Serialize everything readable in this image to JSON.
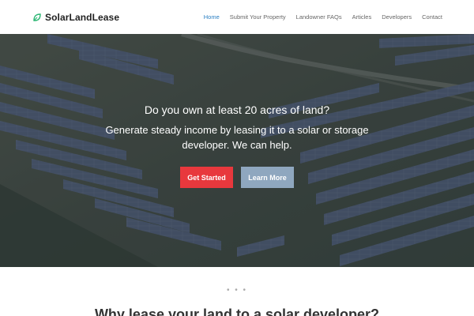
{
  "brand": {
    "name": "SolarLandLease",
    "icon": "leaf-icon",
    "accent": "#2bb673"
  },
  "nav": {
    "items": [
      {
        "label": "Home",
        "active": true
      },
      {
        "label": "Submit Your Property",
        "active": false
      },
      {
        "label": "Landowner FAQs",
        "active": false
      },
      {
        "label": "Articles",
        "active": false
      },
      {
        "label": "Developers",
        "active": false
      },
      {
        "label": "Contact",
        "active": false
      }
    ],
    "active_color": "#2b7fc3"
  },
  "hero": {
    "question": "Do you own at least 20 acres of land?",
    "subtitle": "Generate steady income by leasing it to a solar or storage developer. We can help.",
    "primary_button": "Get Started",
    "secondary_button": "Learn More",
    "primary_color": "#e8383d",
    "secondary_color": "#8fa7bf"
  },
  "section": {
    "dots": "• • •",
    "title": "Why lease your land to a solar developer?"
  }
}
